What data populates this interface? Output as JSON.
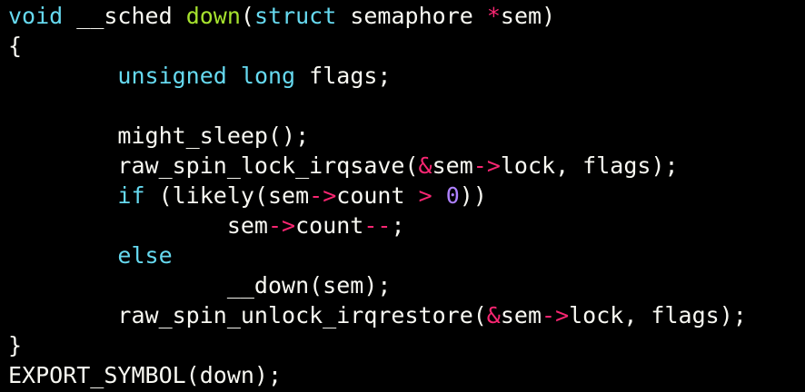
{
  "theme": {
    "background": "#000000",
    "plain": "#f8f8f2",
    "keyword": "#66d9ef",
    "function": "#a6e22e",
    "operator": "#f92672",
    "number": "#ae81ff"
  },
  "code": {
    "lines": [
      [
        {
          "text": "void",
          "kind": "keyword"
        },
        {
          "text": " __sched ",
          "kind": "plain"
        },
        {
          "text": "down",
          "kind": "function"
        },
        {
          "text": "(",
          "kind": "plain"
        },
        {
          "text": "struct",
          "kind": "keyword"
        },
        {
          "text": " semaphore ",
          "kind": "plain"
        },
        {
          "text": "*",
          "kind": "operator"
        },
        {
          "text": "sem)",
          "kind": "plain"
        }
      ],
      [
        {
          "text": "{",
          "kind": "plain"
        }
      ],
      [
        {
          "text": "        ",
          "kind": "plain"
        },
        {
          "text": "unsigned",
          "kind": "keyword"
        },
        {
          "text": " ",
          "kind": "plain"
        },
        {
          "text": "long",
          "kind": "keyword"
        },
        {
          "text": " flags;",
          "kind": "plain"
        }
      ],
      [],
      [
        {
          "text": "        might_sleep();",
          "kind": "plain"
        }
      ],
      [
        {
          "text": "        raw_spin_lock_irqsave(",
          "kind": "plain"
        },
        {
          "text": "&",
          "kind": "operator"
        },
        {
          "text": "sem",
          "kind": "plain"
        },
        {
          "text": "->",
          "kind": "operator"
        },
        {
          "text": "lock, flags);",
          "kind": "plain"
        }
      ],
      [
        {
          "text": "        ",
          "kind": "plain"
        },
        {
          "text": "if",
          "kind": "keyword"
        },
        {
          "text": " (likely(sem",
          "kind": "plain"
        },
        {
          "text": "->",
          "kind": "operator"
        },
        {
          "text": "count ",
          "kind": "plain"
        },
        {
          "text": ">",
          "kind": "operator"
        },
        {
          "text": " ",
          "kind": "plain"
        },
        {
          "text": "0",
          "kind": "number"
        },
        {
          "text": "))",
          "kind": "plain"
        }
      ],
      [
        {
          "text": "                sem",
          "kind": "plain"
        },
        {
          "text": "->",
          "kind": "operator"
        },
        {
          "text": "count",
          "kind": "plain"
        },
        {
          "text": "--",
          "kind": "operator"
        },
        {
          "text": ";",
          "kind": "plain"
        }
      ],
      [
        {
          "text": "        ",
          "kind": "plain"
        },
        {
          "text": "else",
          "kind": "keyword"
        }
      ],
      [
        {
          "text": "                __down(sem);",
          "kind": "plain"
        }
      ],
      [
        {
          "text": "        raw_spin_unlock_irqrestore(",
          "kind": "plain"
        },
        {
          "text": "&",
          "kind": "operator"
        },
        {
          "text": "sem",
          "kind": "plain"
        },
        {
          "text": "->",
          "kind": "operator"
        },
        {
          "text": "lock, flags);",
          "kind": "plain"
        }
      ],
      [
        {
          "text": "}",
          "kind": "plain"
        }
      ],
      [
        {
          "text": "EXPORT_SYMBOL(down);",
          "kind": "plain"
        }
      ]
    ]
  }
}
